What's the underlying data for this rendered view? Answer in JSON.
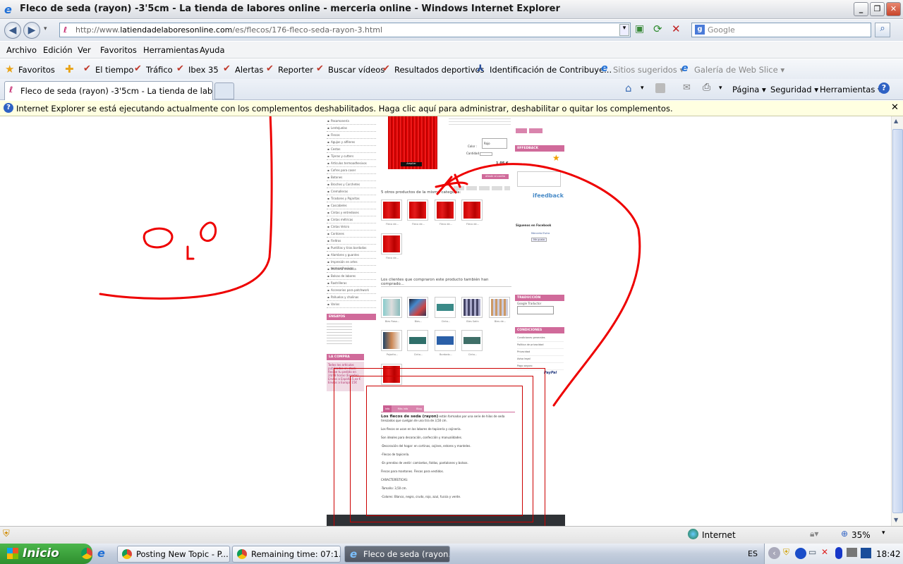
{
  "window": {
    "title": "Fleco de seda (rayon) -3'5cm - La tienda de labores online - merceria online - Windows Internet Explorer",
    "minimize": "_",
    "maximize": "❐",
    "close": "✕"
  },
  "address": {
    "url_prefix": "http://www.",
    "url_domain": "latiendadelaboresonline.com",
    "url_path": "/es/flecos/176-fleco-seda-rayon-3.html",
    "search_placeholder": "Google"
  },
  "menu": [
    "Archivo",
    "Edición",
    "Ver",
    "Favoritos",
    "Herramientas",
    "Ayuda"
  ],
  "favorites": {
    "label": "Favoritos",
    "items": [
      "El tiempo",
      "Tráfico",
      "Ibex 35",
      "Alertas",
      "Reporter",
      "Buscar vídeos",
      "Resultados deportivos",
      "Identificación de Contribuye...",
      "Sitios sugeridos ▾",
      "Galería de Web Slice ▾"
    ]
  },
  "tab": {
    "title": "Fleco de seda (rayon) -3'5cm - La tienda de labores o..."
  },
  "commandbar": {
    "page": "Página ▾",
    "security": "Seguridad ▾",
    "tools": "Herramientas ▾"
  },
  "infobar": {
    "message": "Internet Explorer se está ejecutando actualmente con los complementos deshabilitados. Haga clic aquí para administrar, deshabilitar o quitar los complementos.",
    "close": "✕"
  },
  "webpage": {
    "categories": [
      "Pasamanería",
      "Lentejuelas",
      "Flecos",
      "Agujas y alfileres",
      "Cestas",
      "Tijeras y cutters",
      "Artículos termoadhesivos",
      "Cofres para coser",
      "Botones",
      "Broches y Corchetes",
      "Cremalleras",
      "Tiradores y Pajaritas",
      "Cascabeles",
      "Cintas y entredoses",
      "Cintas métricas",
      "Cintas Velcro",
      "Cordones",
      "Fieltros",
      "Puntillas y tiras bordadas",
      "Alambres y guantes",
      "Impresión en artes termoadhesivas",
      "Mercería metálica",
      "Bolsas de labores",
      "Rastrilleras",
      "Accesorios para patchwork",
      "Pañuelos y chalinas",
      "Varios"
    ],
    "left_box1": "ENSAYOS",
    "left_box2": "LA COMPRA ONLINE",
    "compra_items": [
      "Todos los artículos publicados en stock",
      "Recibe tu pedido en 24/48 horas (España)",
      "Envíos a España 5,xx € Envíos a Europa 15€"
    ],
    "product_options": {
      "color_label": "Color :",
      "color_value": "Rojo",
      "qty_label": "Cantidad :",
      "price": "1,05 €",
      "add_button": "Añadir al carrito",
      "zoom_label": "Ampliar"
    },
    "same_category_title": "5 otros productos de la misma categoría:",
    "same_category_caption": "Fleco de...",
    "also_bought_title": "Los clientes que compraron este producto también han comprado...",
    "also_bought_captions": [
      "Bies Raso...",
      "Bies...",
      "Cinta...",
      "Bies Satin",
      "Bies de...",
      "Pajarita...",
      "Cinta...",
      "Bordado...",
      "Cinta..."
    ],
    "tabs": [
      "Info",
      "Más info",
      "Blog"
    ],
    "description_lead": "Los flecos de seda (rayon)",
    "description_lines": [
      "están formados por una serie de hilos de seda trenzados que cuelgan de una tira de 3,50 cm.",
      "Los flecos se usan en las labores de tapicería y cojinería.",
      "Son ideales para decoración, confección y manualidades.",
      "-Decoración del hogar: en cortinas, cojines, estores y manteles.",
      "-Flecos de tapicería.",
      "-En prendas de vestir: camisetas, faldas, pantalones y bolsos.",
      "Flecos para mantones. Flecos para vestidos.",
      "CARACTERÍSTICAS:",
      "-Tamaño: 3,50 cm.",
      "-Colores: Blanco, negro, crudo, rojo, azul, fucsia y verde."
    ],
    "right_box1": "IIFFEDBACK",
    "ifeedback": "ifeedback",
    "right_box2": "Síguenos en Facebook",
    "facebook_name": "Mercería Elvira",
    "like": "Me gusta",
    "right_box3": "TRADUCCIÓN",
    "translator": "Google Traductor",
    "right_box4": "CONDICIONES",
    "conditions": [
      "Condiciones generales",
      "Política de privacidad",
      "Privacidad",
      "Aviso legal",
      "Pago seguro"
    ],
    "paypal": "PayPal"
  },
  "status": {
    "zone": "Internet",
    "zoom": "35%"
  },
  "taskbar": {
    "start": "Inicio",
    "tasks": [
      "Posting New Topic - P...",
      "Remaining time: 07:1...",
      "Fleco de seda (rayon..."
    ],
    "lang": "ES",
    "clock": "18:42"
  }
}
